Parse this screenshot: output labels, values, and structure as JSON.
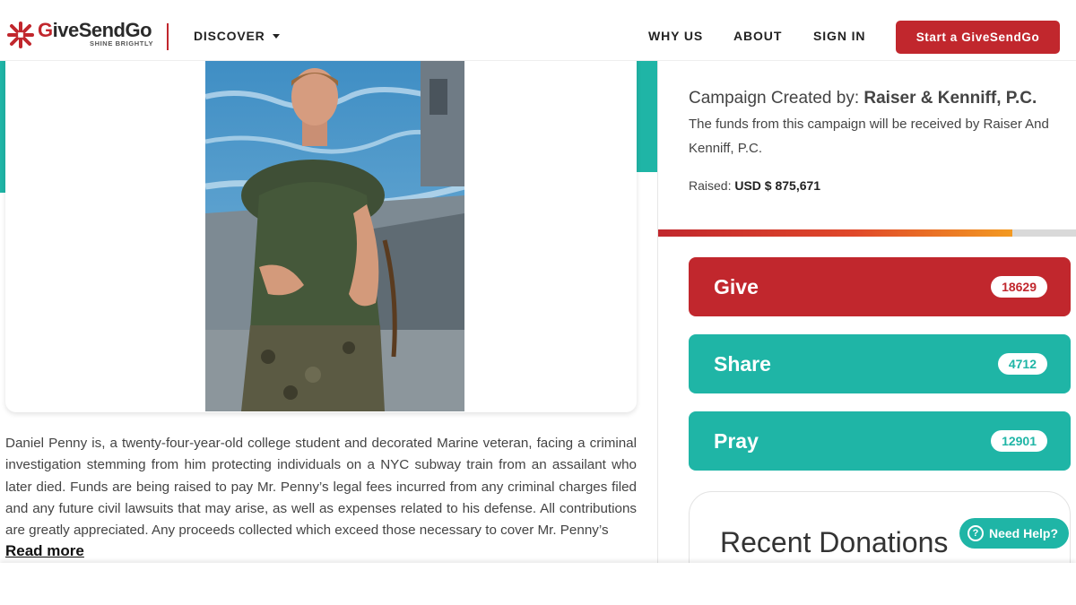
{
  "header": {
    "logo_word_1": "G",
    "logo_word_2": "iveSendGo",
    "logo_tagline": "SHINE BRIGHTLY",
    "discover_label": "DISCOVER",
    "nav": [
      "WHY US",
      "ABOUT",
      "SIGN IN"
    ],
    "start_button": "Start a GiveSendGo"
  },
  "campaign": {
    "description": "Daniel Penny is, a twenty-four-year-old college student and decorated Marine veteran, facing a criminal investigation stemming from him protecting individuals on a NYC subway train from an assailant who later died. Funds are being raised to pay Mr. Penny’s legal fees incurred from any criminal charges filed and any future civil lawsuits that may arise, as well as expenses related to his defense. All contributions are greatly appreciated. Any proceeds collected which exceed those necessary to cover Mr. Penny’s",
    "read_more": "Read more"
  },
  "sidebar": {
    "created_by_label": "Campaign Created by:",
    "created_by_name": "Raiser & Kenniff, P.C.",
    "funds_text": "The funds from this campaign will be received by Raiser And Kenniff, P.C.",
    "raised_label": "Raised:",
    "raised_value": "USD $ 875,671",
    "progress_fraction": 0.847,
    "give_label": "Give",
    "give_count": "18629",
    "share_label": "Share",
    "share_count": "4712",
    "pray_label": "Pray",
    "pray_count": "12901",
    "recent_donations_title": "Recent Donations"
  },
  "help": {
    "label": "Need Help?"
  },
  "colors": {
    "brand_red": "#c1272d",
    "teal": "#1fb5a6"
  }
}
